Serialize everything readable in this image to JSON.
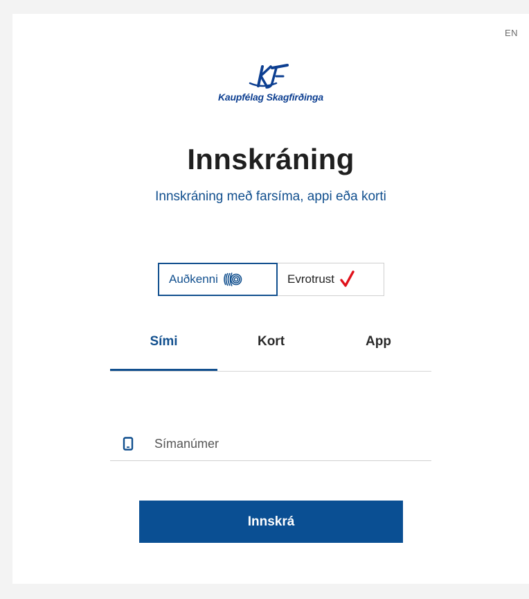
{
  "lang_switch": "EN",
  "brand": {
    "name": "Kaupfélag Skagfirðinga",
    "color": "#0d3f91"
  },
  "title": "Innskráning",
  "subtitle": "Innskráning með farsíma, appi eða korti",
  "providers": [
    {
      "label": "Auðkenni",
      "icon": "fingerprint-icon",
      "selected": true
    },
    {
      "label": "Evrotrust",
      "icon": "checkmark-icon",
      "selected": false
    }
  ],
  "tabs": [
    {
      "label": "Sími",
      "active": true
    },
    {
      "label": "Kort",
      "active": false
    },
    {
      "label": "App",
      "active": false
    }
  ],
  "phone_field": {
    "placeholder": "Símanúmer",
    "value": "",
    "icon": "mobile-phone-icon"
  },
  "submit_label": "Innskrá",
  "colors": {
    "accent": "#114f8e",
    "button": "#0a4f93",
    "check": "#e0121b"
  }
}
